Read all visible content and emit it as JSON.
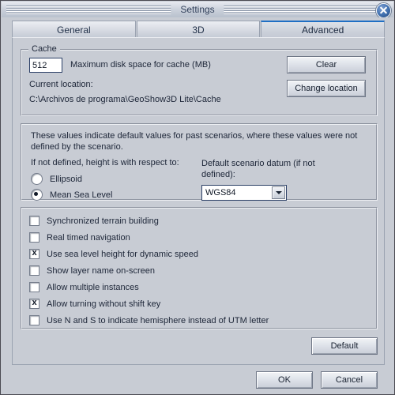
{
  "window": {
    "title": "Settings",
    "close_icon": "close-icon"
  },
  "tabs": [
    {
      "label": "General",
      "active": false
    },
    {
      "label": "3D",
      "active": false
    },
    {
      "label": "Advanced",
      "active": true
    }
  ],
  "cache": {
    "legend": "Cache",
    "max_disk_value": "512",
    "max_disk_label": "Maximum disk space for cache (MB)",
    "current_location_label": "Current location:",
    "current_location_path": "C:\\Archivos de programa\\GeoShow3D Lite\\Cache",
    "clear_button": "Clear",
    "change_location_button": "Change location"
  },
  "defaults": {
    "description": "These values indicate default values for past scenarios, where these values were not defined by the scenario.",
    "height_ref_label": "If not defined, height is with respect to:",
    "radios": [
      {
        "label": "Ellipsoid",
        "selected": false
      },
      {
        "label": "Mean Sea Level",
        "selected": true
      }
    ],
    "datum_label": "Default scenario datum (if not defined):",
    "datum_value": "WGS84",
    "datum_arrow_icon": "chevron-down-icon"
  },
  "options": {
    "items": [
      {
        "label": "Synchronized terrain building",
        "checked": false
      },
      {
        "label": "Real timed navigation",
        "checked": false
      },
      {
        "label": "Use sea level height for dynamic speed",
        "checked": true
      },
      {
        "label": "Show layer name on-screen",
        "checked": false
      },
      {
        "label": "Allow multiple instances",
        "checked": false
      },
      {
        "label": "Allow turning without shift key",
        "checked": true
      },
      {
        "label": "Use N and S to indicate hemisphere instead of UTM letter",
        "checked": false
      }
    ]
  },
  "actions": {
    "default_button": "Default",
    "ok_button": "OK",
    "cancel_button": "Cancel"
  },
  "colors": {
    "window_bg": "#c8ccd4",
    "accent_tab": "#1f6fc4",
    "title_text": "#33425c",
    "body_text": "#1d2638"
  }
}
